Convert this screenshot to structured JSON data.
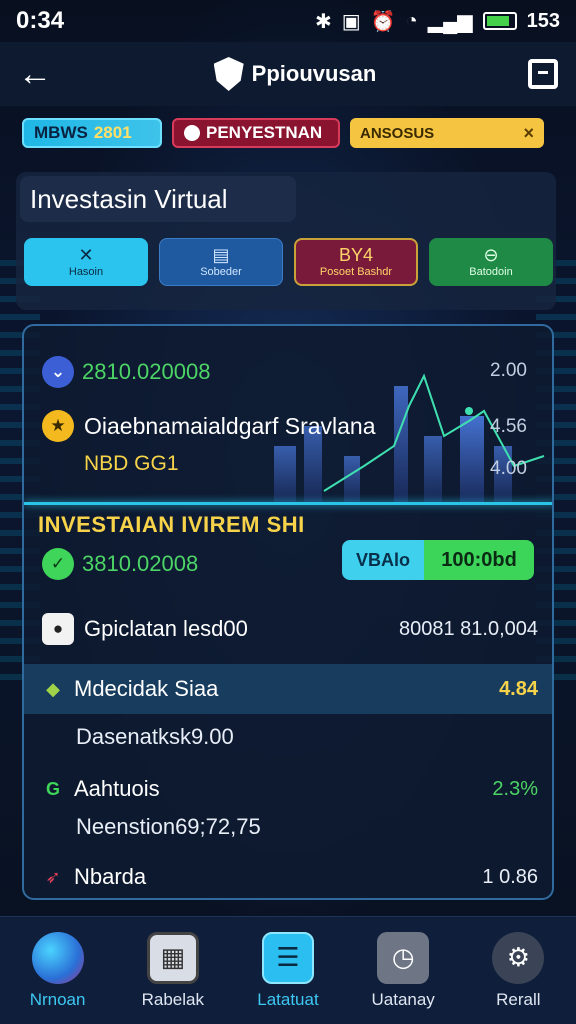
{
  "status": {
    "time": "0:34",
    "battery": "153"
  },
  "header": {
    "title": "Ppiouvusan"
  },
  "chips": [
    {
      "label": "MBWS",
      "value": "2801"
    },
    {
      "label": "PENYESTNAN"
    },
    {
      "label": "ANSOSUS",
      "close": "×"
    }
  ],
  "virtual": {
    "title": "Investasin Virtual",
    "actions": [
      {
        "label": "Hasoin",
        "icon": "✕"
      },
      {
        "label": "Sobeder",
        "icon": "▤"
      },
      {
        "label": "Posoet Bashdr",
        "icon": "BY4"
      },
      {
        "label": "Batodoin",
        "icon": "⊖"
      }
    ]
  },
  "main": {
    "top_row": {
      "value": "2810.020008",
      "axis": "2.00"
    },
    "second_row": {
      "name": "Oiaebnamaialdgarf Sravlana",
      "axis": "4.56"
    },
    "sub_label": "NBD GG1",
    "third_axis": "4.00",
    "section_title": "INVESTAIAN IVIREM SHI",
    "section_value": "3810.02008",
    "pill_left": "VBAlo",
    "pill_right": "100:0bd",
    "rows": [
      {
        "name": "Gpiclatan lesd00",
        "value": "80081 81.0,004"
      },
      {
        "name": "Mdecidak Siaa",
        "value": "4.84"
      },
      {
        "name": "Dasenatksk9.00",
        "value": ""
      },
      {
        "name": "Aahtuois",
        "value": "2.3%"
      },
      {
        "name": "Neenstion69;72,75",
        "value": ""
      },
      {
        "name": "Nbarda",
        "value": "1  0.86"
      }
    ]
  },
  "nav": [
    {
      "label": "Nrnoan"
    },
    {
      "label": "Rabelak"
    },
    {
      "label": "Latatuat"
    },
    {
      "label": "Uatanay"
    },
    {
      "label": "Rerall"
    }
  ],
  "colors": {
    "accent_cyan": "#29c4e8",
    "accent_green": "#4cd466",
    "accent_yellow": "#f7d34a",
    "panel_bg": "#0e1a30"
  }
}
